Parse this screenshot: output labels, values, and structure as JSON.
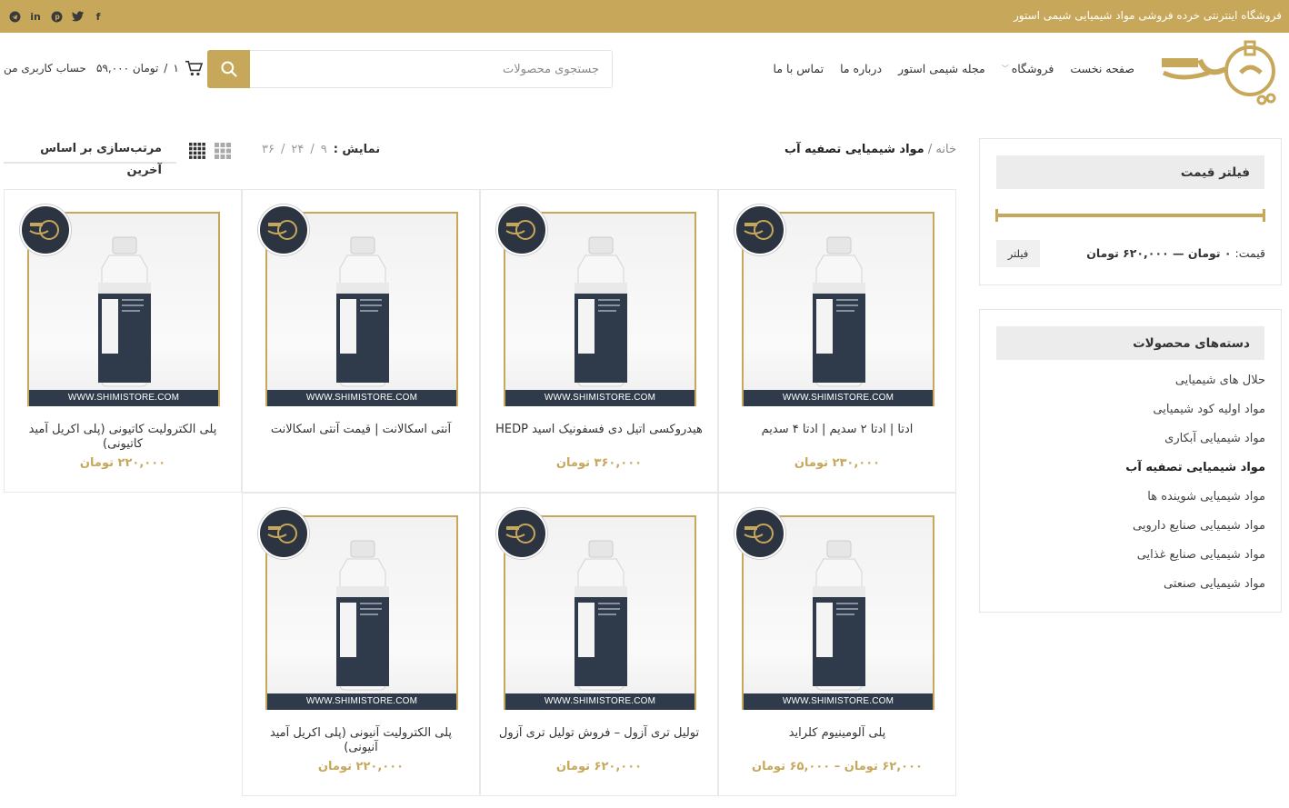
{
  "topbar": {
    "tagline": "فروشگاه اینترنتی خرده فروشی مواد شیمیایی شیمی استور",
    "social": [
      "facebook-icon",
      "twitter-icon",
      "pinterest-icon",
      "linkedin-icon",
      "telegram-icon"
    ]
  },
  "brand": {
    "accent": "#c7a85b",
    "dark": "#2f3a4a"
  },
  "nav": {
    "items": [
      "صفحه نخست",
      "فروشگاه",
      "مجله شیمی استور",
      "درباره ما",
      "تماس با ما"
    ]
  },
  "search": {
    "placeholder": "جستجوی محصولات"
  },
  "cart": {
    "count": "۱",
    "total": "۵۹,۰۰۰ تومان"
  },
  "account": {
    "label": "حساب کاربری من"
  },
  "breadcrumb": {
    "home": "خانه",
    "separator": "/",
    "current": "مواد شیمیایی تصفیه آب"
  },
  "toolbar": {
    "show_label": "نمایش :",
    "per_page": [
      "۹",
      "۲۴",
      "۳۶"
    ],
    "sort_label": "مرتب‌سازی بر اساس آخرین"
  },
  "price_filter": {
    "title": "فیلتر قیمت",
    "button": "فیلتر",
    "price_prefix": "قیمت:",
    "price_range": "۰ تومان — ۶۲۰,۰۰۰ تومان"
  },
  "categories": {
    "title": "دسته‌های محصولات",
    "items": [
      "حلال های شیمیایی",
      "مواد اولیه کود شیمیایی",
      "مواد شیمیایی آبکاری",
      "مواد شیمیایی تصفیه آب",
      "مواد شیمیایی شوینده ها",
      "مواد شیمیایی صنایع دارویی",
      "مواد شیمیایی صنایع غذایی",
      "مواد شیمیایی صنعتی"
    ],
    "active": "مواد شیمیایی تصفیه آب"
  },
  "products": [
    {
      "title": "ادتا | ادتا ۲ سدیم | ادتا ۴ سدیم",
      "price": "۲۳۰,۰۰۰ تومان",
      "label": "Edta",
      "site": "WWW.SHIMISTORE.COM"
    },
    {
      "title": "هیدروکسی اتیل دی فسفونیک اسید HEDP",
      "price": "۳۶۰,۰۰۰ تومان",
      "label": "Hedp",
      "site": "WWW.SHIMISTORE.COM"
    },
    {
      "title": "آنتی اسکالانت | قیمت آنتی اسکالانت",
      "price": "",
      "label": "Antiscalants",
      "site": "WWW.SHIMISTORE.COM"
    },
    {
      "title": "پلی الکترولیت کاتیونی (پلی اکریل آمید کاتیونی)",
      "price": "۲۲۰,۰۰۰ تومان",
      "label": "Cationic Polyelectrolyte",
      "site": "WWW.SHIMISTORE.COM"
    },
    {
      "title": "پلی آلومینیوم کلراید",
      "price": "۶۲,۰۰۰ تومان – ۶۵,۰۰۰ تومان",
      "label": "Poly Aluminium Chloride",
      "site": "WWW.SHIMISTORE.COM"
    },
    {
      "title": "تولیل تری آزول – فروش تولیل تری آزول",
      "price": "۶۲۰,۰۰۰ تومان",
      "label": "Tolyltriazole",
      "site": "WWW.SHIMISTORE.COM"
    },
    {
      "title": "پلی الکترولیت آنیونی (پلی اکریل آمید آنیونی)",
      "price": "۲۲۰,۰۰۰ تومان",
      "label": "Anionic Polyelectrolyte",
      "site": "WWW.SHIMISTORE.COM"
    }
  ]
}
